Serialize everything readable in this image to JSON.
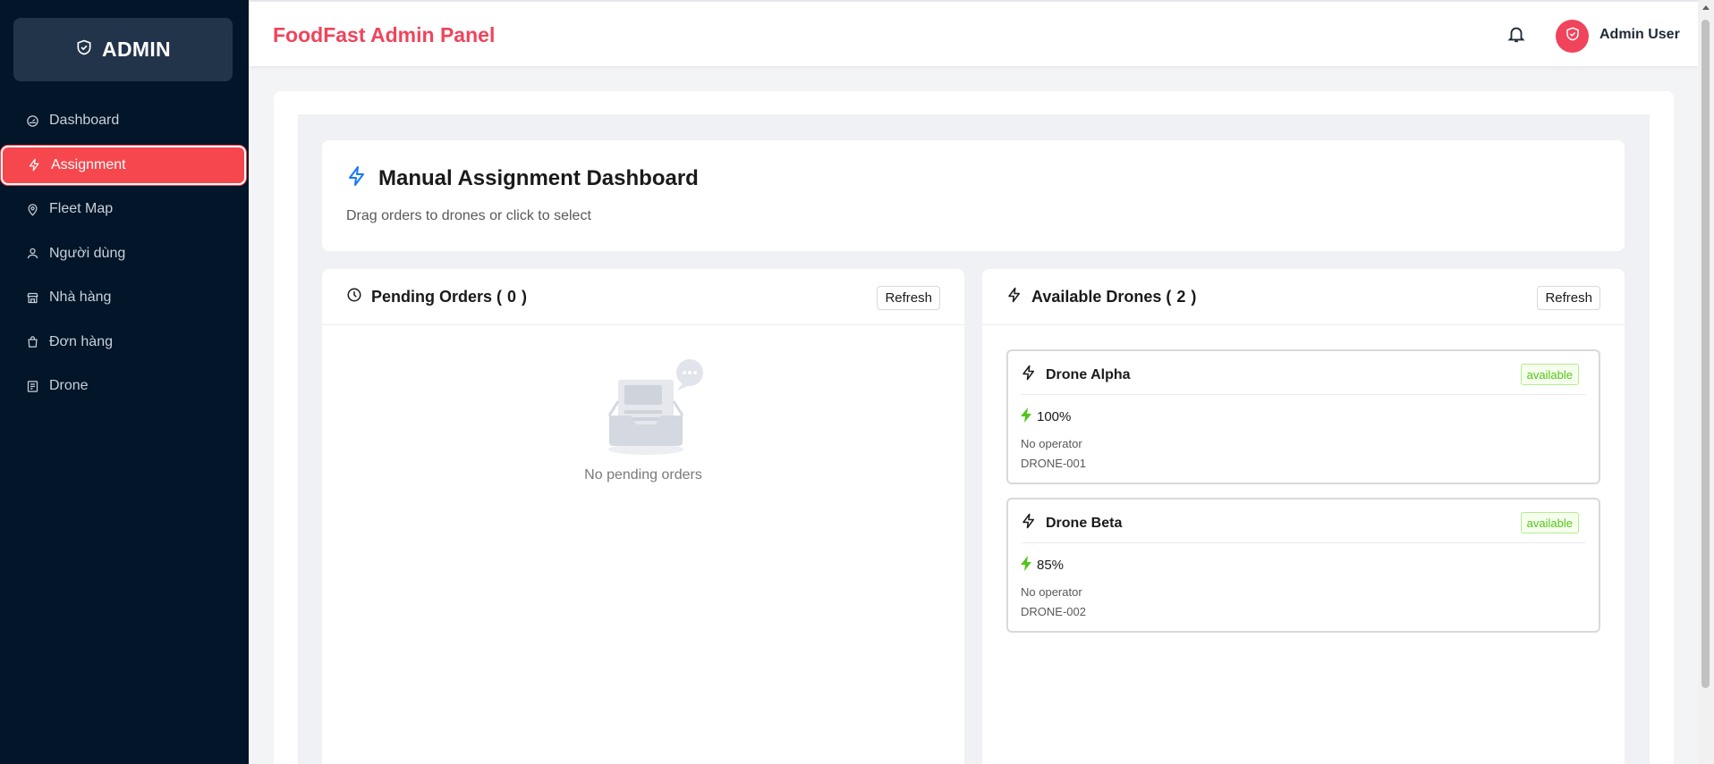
{
  "sidebar": {
    "brand": "ADMIN",
    "items": [
      {
        "label": "Dashboard",
        "icon": "dashboard-icon"
      },
      {
        "label": "Assignment",
        "icon": "lightning-icon",
        "active": true
      },
      {
        "label": "Fleet Map",
        "icon": "map-pin-icon"
      },
      {
        "label": "Người dùng",
        "icon": "user-icon"
      },
      {
        "label": "Nhà hàng",
        "icon": "shop-icon"
      },
      {
        "label": "Đơn hàng",
        "icon": "shopping-bag-icon"
      },
      {
        "label": "Drone",
        "icon": "drone-icon"
      }
    ]
  },
  "header": {
    "title": "FoodFast Admin Panel",
    "user_name": "Admin User",
    "icons": {
      "notification": "bell-icon",
      "avatar": "shield-icon"
    }
  },
  "main": {
    "title": "Manual Assignment Dashboard",
    "subtitle": "Drag orders to drones or click to select",
    "pending": {
      "label": "Pending Orders (",
      "count": "0",
      "close": ")",
      "refresh_label": "Refresh",
      "empty_text": "No pending orders"
    },
    "drones": {
      "label": "Available Drones (",
      "count": "2",
      "close": ")",
      "refresh_label": "Refresh",
      "items": [
        {
          "name": "Drone Alpha",
          "status": "available",
          "battery": "100%",
          "operator": "No operator",
          "code": "DRONE-001"
        },
        {
          "name": "Drone Beta",
          "status": "available",
          "battery": "85%",
          "operator": "No operator",
          "code": "DRONE-002"
        }
      ]
    }
  },
  "colors": {
    "sidebar_bg": "#021529",
    "accent": "#f0445c",
    "active_nav": "#f5474d",
    "status_green": "#52c41a",
    "lightning_blue": "#1677ff"
  }
}
